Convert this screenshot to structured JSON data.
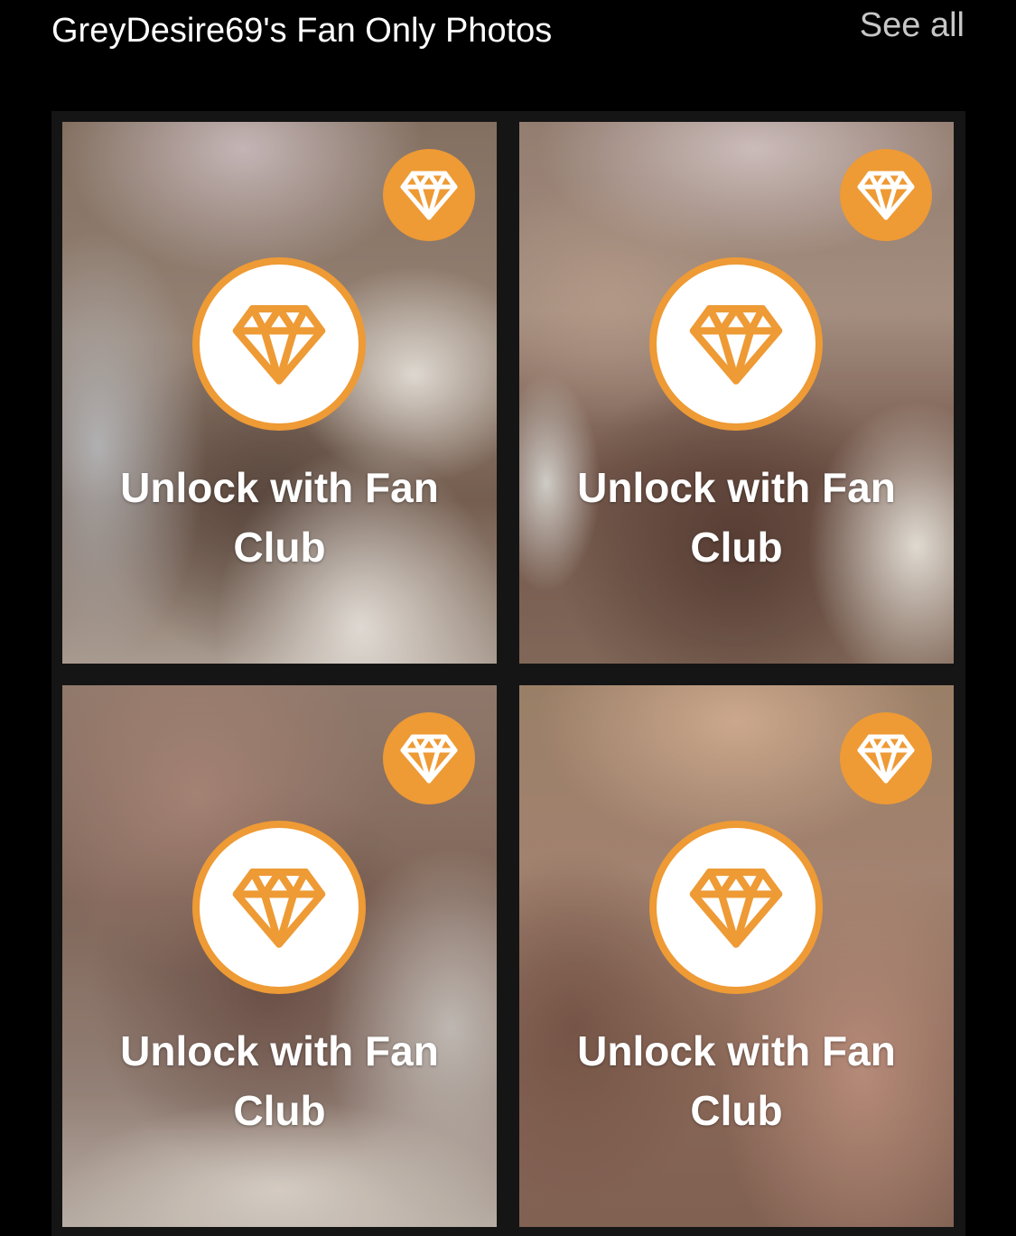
{
  "header": {
    "title": "GreyDesire69's Fan Only Photos",
    "see_all_label": "See all"
  },
  "colors": {
    "background": "#000000",
    "grid_background": "#151515",
    "accent_orange": "#ee9a35",
    "text_white": "#ffffff",
    "link_grey": "#c7c7c7"
  },
  "tiles": [
    {
      "badge_icon": "diamond-icon",
      "center_icon": "diamond-icon",
      "label": "Unlock with Fan Club"
    },
    {
      "badge_icon": "diamond-icon",
      "center_icon": "diamond-icon",
      "label": "Unlock with Fan Club"
    },
    {
      "badge_icon": "diamond-icon",
      "center_icon": "diamond-icon",
      "label": "Unlock with Fan Club"
    },
    {
      "badge_icon": "diamond-icon",
      "center_icon": "diamond-icon",
      "label": "Unlock with Fan Club"
    }
  ]
}
